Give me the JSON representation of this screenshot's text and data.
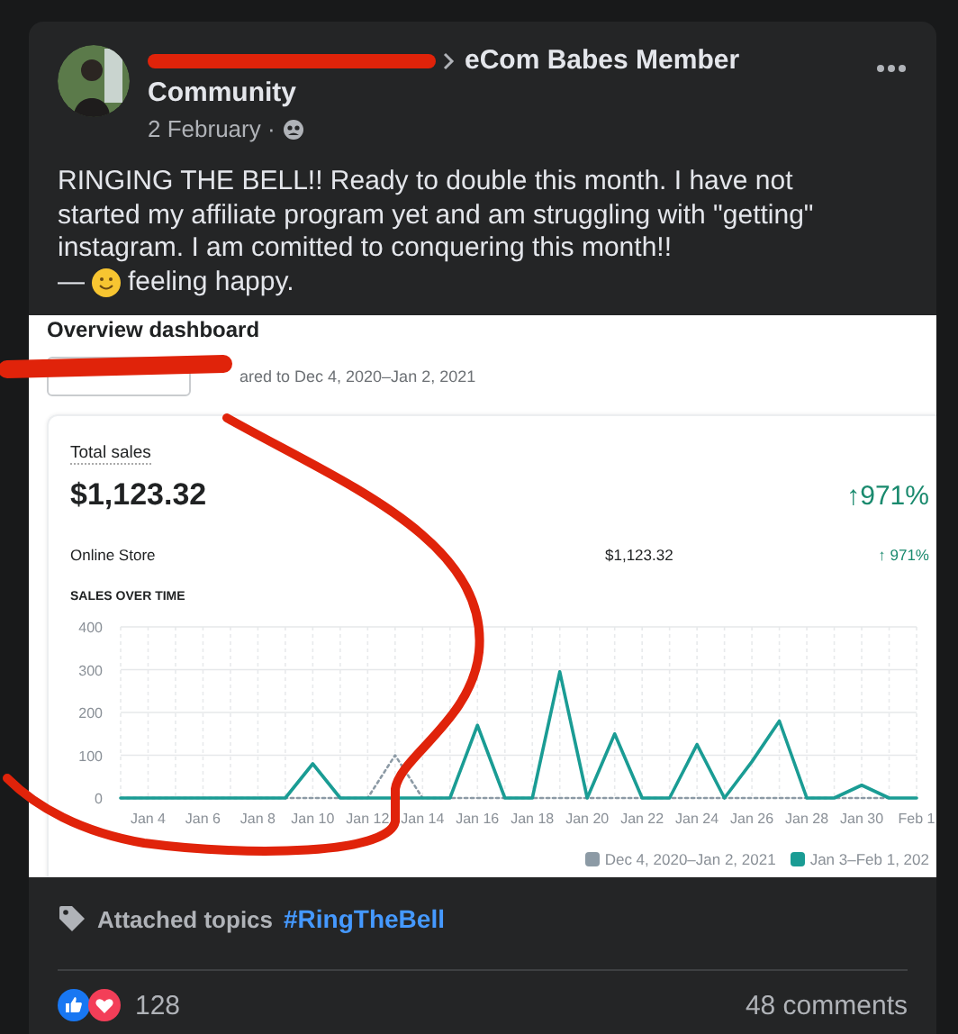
{
  "post": {
    "group": "eCom Babes Member Community",
    "date": "2 February ·",
    "text": "RINGING THE BELL!! Ready to double this month. I have not started my affiliate program yet and am struggling with \"getting\" instagram. I am comitted to conquering this month!!",
    "dash": "—",
    "feeling": "feeling happy."
  },
  "shared_image": {
    "title": "Overview dashboard",
    "comparison": "ared to Dec 4, 2020–Jan 2, 2021",
    "total_sales": {
      "label": "Total sales",
      "value": "$1,123.32",
      "change": "↑971%"
    },
    "breakdown": [
      {
        "channel": "Online Store",
        "value": "$1,123.32",
        "change": "↑ 971%"
      }
    ],
    "chart_title": "SALES OVER TIME",
    "chart_data": {
      "type": "line",
      "categories": [
        null,
        "Jan 4",
        null,
        "Jan 6",
        null,
        "Jan 8",
        null,
        "Jan 10",
        null,
        "Jan 12",
        null,
        "Jan 14",
        null,
        "Jan 16",
        null,
        "Jan 18",
        null,
        "Jan 20",
        null,
        "Jan 22",
        null,
        "Jan 24",
        null,
        "Jan 26",
        null,
        "Jan 28",
        null,
        "Jan 30",
        null,
        "Feb 1"
      ],
      "yticks": [
        0,
        100,
        200,
        300,
        400
      ],
      "ylim": [
        0,
        400
      ],
      "grid": true,
      "legend": "bottom-right",
      "series": [
        {
          "name": "Dec 4, 2020–Jan 2, 2021",
          "color": "#8c9aa5",
          "line_style": "dotted",
          "values": [
            0,
            0,
            0,
            0,
            0,
            0,
            0,
            0,
            0,
            0,
            100,
            0,
            0,
            0,
            0,
            0,
            0,
            0,
            0,
            0,
            0,
            0,
            0,
            0,
            0,
            0,
            0,
            0,
            0,
            null
          ]
        },
        {
          "name": "Jan 3–Feb 1, 202",
          "color": "#1a9c94",
          "line_style": "solid",
          "values": [
            0,
            0,
            0,
            0,
            0,
            0,
            0,
            80,
            0,
            0,
            0,
            0,
            0,
            170,
            0,
            0,
            295,
            0,
            150,
            0,
            0,
            125,
            0,
            85,
            180,
            0,
            0,
            30,
            0,
            0
          ]
        }
      ]
    }
  },
  "topics": {
    "label": "Attached topics",
    "tags": [
      "#RingTheBell"
    ]
  },
  "reactions": {
    "count": "128",
    "comments": "48 comments"
  }
}
